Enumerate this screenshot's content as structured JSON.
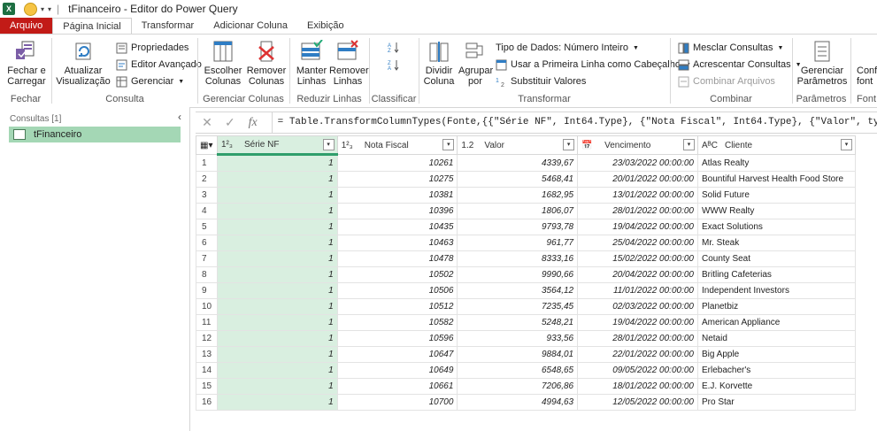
{
  "titlebar": {
    "app_icon": "X",
    "title": "tFinanceiro - Editor do Power Query"
  },
  "tabs": [
    "Arquivo",
    "Página Inicial",
    "Transformar",
    "Adicionar Coluna",
    "Exibição"
  ],
  "ribbon": {
    "fechar": {
      "btn": "Fechar e\nCarregar",
      "label": "Fechar"
    },
    "consulta": {
      "atualizar": "Atualizar\nVisualização",
      "propriedades": "Propriedades",
      "editor": "Editor Avançado",
      "gerenciar": "Gerenciar",
      "label": "Consulta"
    },
    "colunas": {
      "escolher": "Escolher\nColunas",
      "remover": "Remover\nColunas",
      "label": "Gerenciar Colunas"
    },
    "linhas": {
      "manter": "Manter\nLinhas",
      "remover": "Remover\nLinhas",
      "label": "Reduzir Linhas"
    },
    "classificar": {
      "label": "Classificar"
    },
    "transformar": {
      "dividir": "Dividir\nColuna",
      "agrupar": "Agrupar\npor",
      "tipo": "Tipo de Dados: Número Inteiro",
      "primeira": "Usar a Primeira Linha como Cabeçalho",
      "substituir": "Substituir Valores",
      "label": "Transformar"
    },
    "combinar": {
      "mesclar": "Mesclar Consultas",
      "acrescentar": "Acrescentar Consultas",
      "arquivos": "Combinar Arquivos",
      "label": "Combinar"
    },
    "parametros": {
      "gerenciar": "Gerenciar\nParâmetros",
      "label": "Parâmetros"
    },
    "fonte": {
      "btn": "Conf\nfont",
      "label": "Font"
    }
  },
  "left_pane": {
    "title": "Consultas [1]",
    "query": "tFinanceiro"
  },
  "formula": {
    "text": "= Table.TransformColumnTypes(Fonte,{{\"Série NF\", Int64.Type}, {\"Nota Fiscal\", Int64.Type}, {\"Valor\", type number}, {\"Ve"
  },
  "columns": [
    {
      "type": "1²₃",
      "name": "Série NF"
    },
    {
      "type": "1²₃",
      "name": "Nota Fiscal"
    },
    {
      "type": "1.2",
      "name": "Valor"
    },
    {
      "type": "cal",
      "name": "Vencimento"
    },
    {
      "type": "AᴮC",
      "name": "Cliente"
    }
  ],
  "rows": [
    [
      "1",
      "1",
      "10261",
      "4339,67",
      "23/03/2022 00:00:00",
      "Atlas Realty"
    ],
    [
      "2",
      "1",
      "10275",
      "5468,41",
      "20/01/2022 00:00:00",
      "Bountiful Harvest Health Food Store"
    ],
    [
      "3",
      "1",
      "10381",
      "1682,95",
      "13/01/2022 00:00:00",
      "Solid Future"
    ],
    [
      "4",
      "1",
      "10396",
      "1806,07",
      "28/01/2022 00:00:00",
      "WWW Realty"
    ],
    [
      "5",
      "1",
      "10435",
      "9793,78",
      "19/04/2022 00:00:00",
      "Exact Solutions"
    ],
    [
      "6",
      "1",
      "10463",
      "961,77",
      "25/04/2022 00:00:00",
      "Mr. Steak"
    ],
    [
      "7",
      "1",
      "10478",
      "8333,16",
      "15/02/2022 00:00:00",
      "County Seat"
    ],
    [
      "8",
      "1",
      "10502",
      "9990,66",
      "20/04/2022 00:00:00",
      "Britling Cafeterias"
    ],
    [
      "9",
      "1",
      "10506",
      "3564,12",
      "11/01/2022 00:00:00",
      "Independent Investors"
    ],
    [
      "10",
      "1",
      "10512",
      "7235,45",
      "02/03/2022 00:00:00",
      "Planetbiz"
    ],
    [
      "11",
      "1",
      "10582",
      "5248,21",
      "19/04/2022 00:00:00",
      "American Appliance"
    ],
    [
      "12",
      "1",
      "10596",
      "933,56",
      "28/01/2022 00:00:00",
      "Netaid"
    ],
    [
      "13",
      "1",
      "10647",
      "9884,01",
      "22/01/2022 00:00:00",
      "Big Apple"
    ],
    [
      "14",
      "1",
      "10649",
      "6548,65",
      "09/05/2022 00:00:00",
      "Erlebacher's"
    ],
    [
      "15",
      "1",
      "10661",
      "7206,86",
      "18/01/2022 00:00:00",
      "E.J. Korvette"
    ],
    [
      "16",
      "1",
      "10700",
      "4994,63",
      "12/05/2022 00:00:00",
      "Pro Star"
    ]
  ]
}
